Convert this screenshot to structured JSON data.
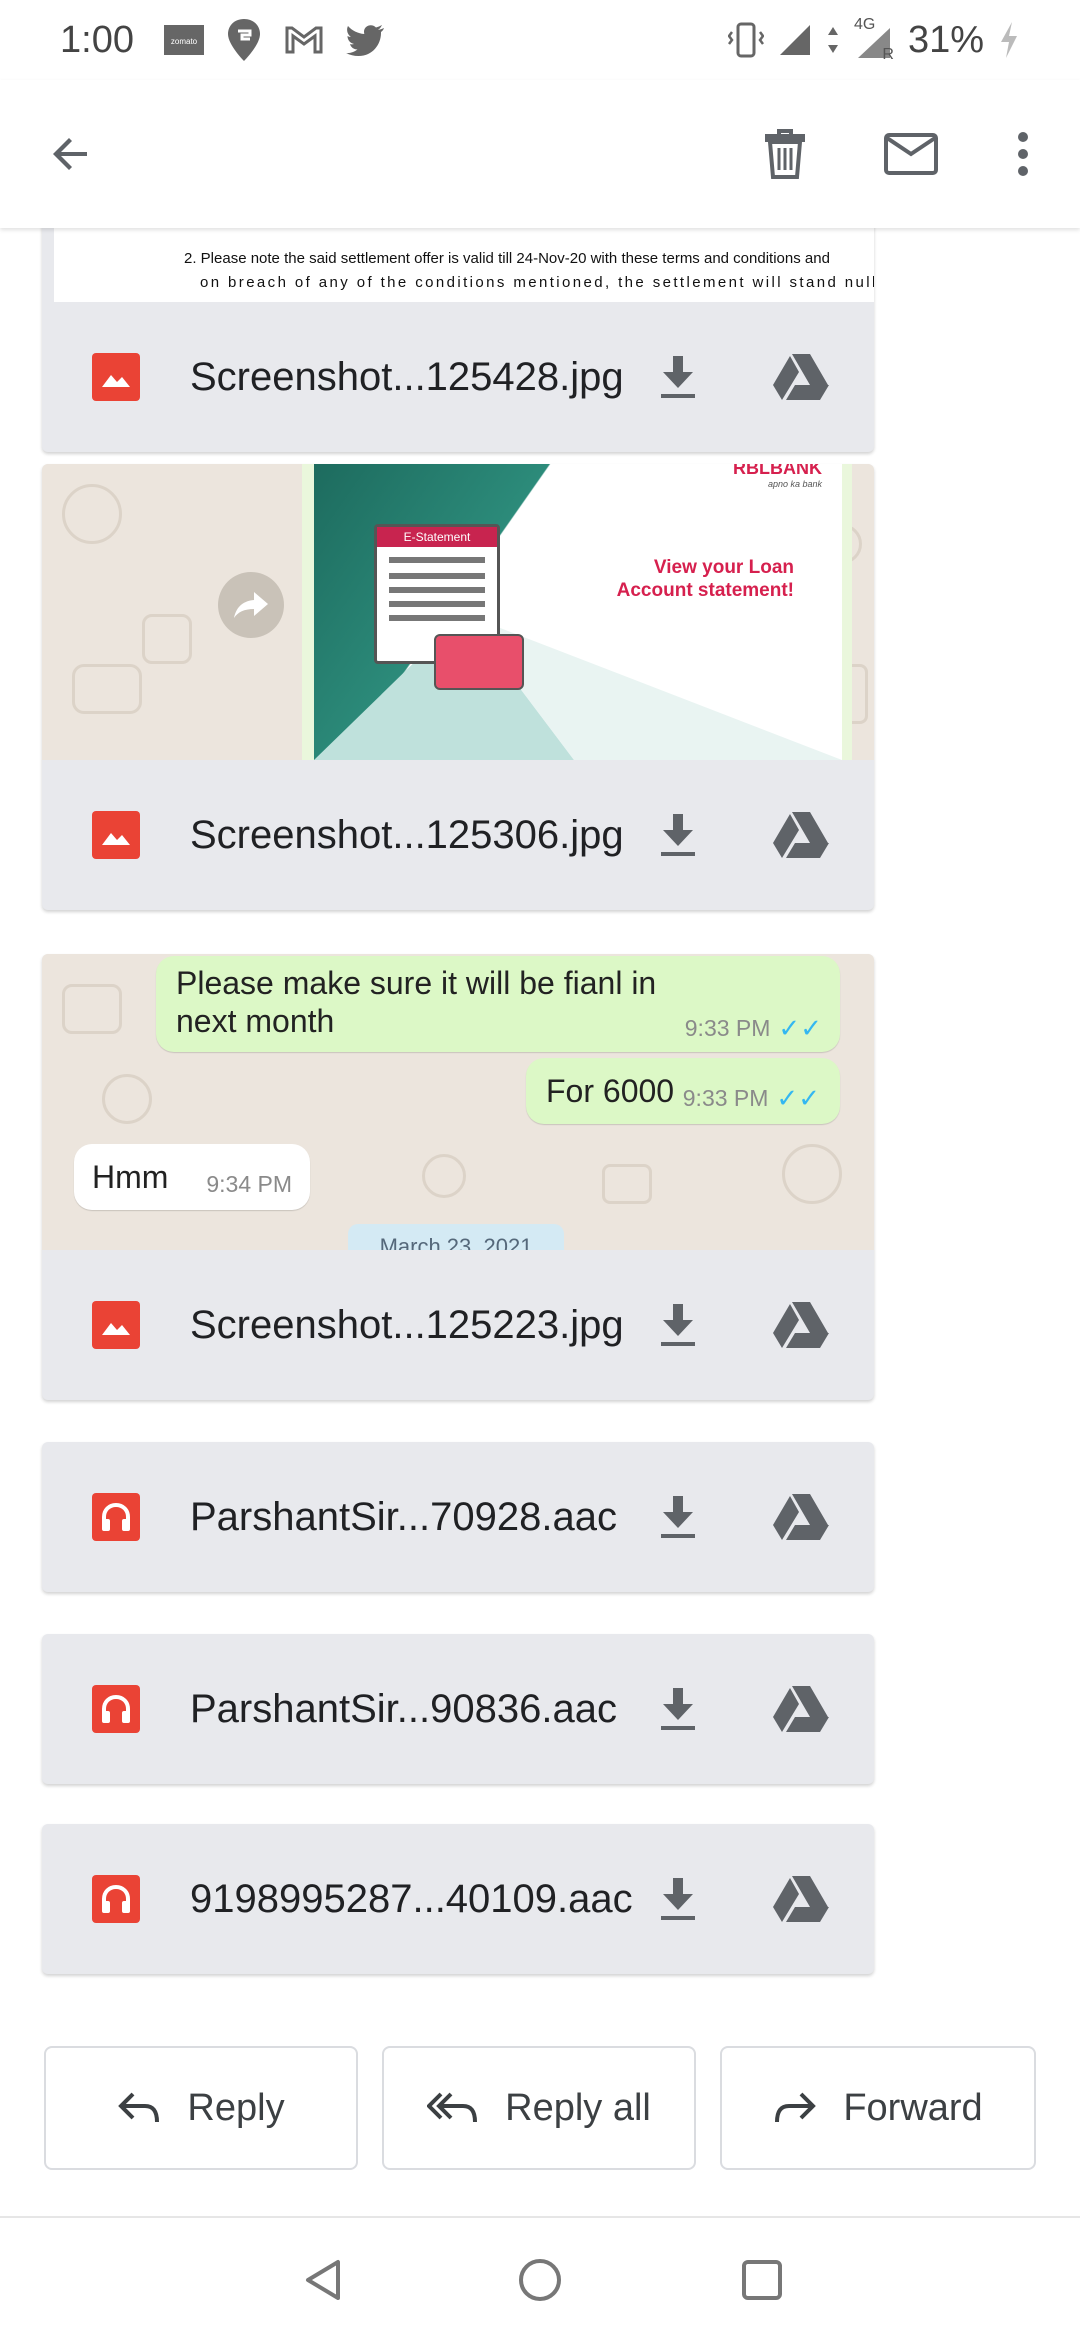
{
  "status_bar": {
    "time": "1:00",
    "app_icons": [
      "zomato",
      "swiggy",
      "gmail",
      "twitter"
    ],
    "zomato_label": "zomato",
    "network": "4G",
    "roaming": "R",
    "battery": "31%"
  },
  "toolbar": {
    "back": "arrow-back-icon",
    "actions": [
      "delete-icon",
      "mark-unread-icon",
      "more-vert-icon"
    ]
  },
  "attachments": [
    {
      "name": "Screenshot...125428.jpg",
      "type": "image",
      "preview_text_1": "2.   Please note the said settlement offer is valid till 24-Nov-20 with these terms and conditions and",
      "preview_text_2": "on breach of any of the conditions mentioned, the settlement will stand null & void with"
    },
    {
      "name": "Screenshot...125306.jpg",
      "type": "image",
      "preview_bank": "RBLBANK",
      "preview_tagline": "apno ka bank",
      "preview_card_title": "E-Statement",
      "preview_promo": "View your Loan Account statement!"
    },
    {
      "name": "Screenshot...125223.jpg",
      "type": "image",
      "messages": [
        {
          "text": "Please make sure it will be fianl in next month",
          "time": "9:33 PM",
          "dir": "out"
        },
        {
          "text": "For 6000",
          "time": "9:33 PM",
          "dir": "out"
        },
        {
          "text": "Hmm",
          "time": "9:34 PM",
          "dir": "in"
        }
      ],
      "date_chip": "March 23, 2021"
    },
    {
      "name": "ParshantSir...70928.aac",
      "type": "audio"
    },
    {
      "name": "ParshantSir...90836.aac",
      "type": "audio"
    },
    {
      "name": "9198995287...40109.aac",
      "type": "audio"
    }
  ],
  "actions": {
    "reply": "Reply",
    "reply_all": "Reply all",
    "forward": "Forward"
  },
  "colors": {
    "attachment_bg": "#e8e9ed",
    "file_icon_red": "#ea4335",
    "wa_out_bubble": "#dcf8c6",
    "wa_bg": "#ece5dd",
    "rbl_red": "#d6204e"
  }
}
